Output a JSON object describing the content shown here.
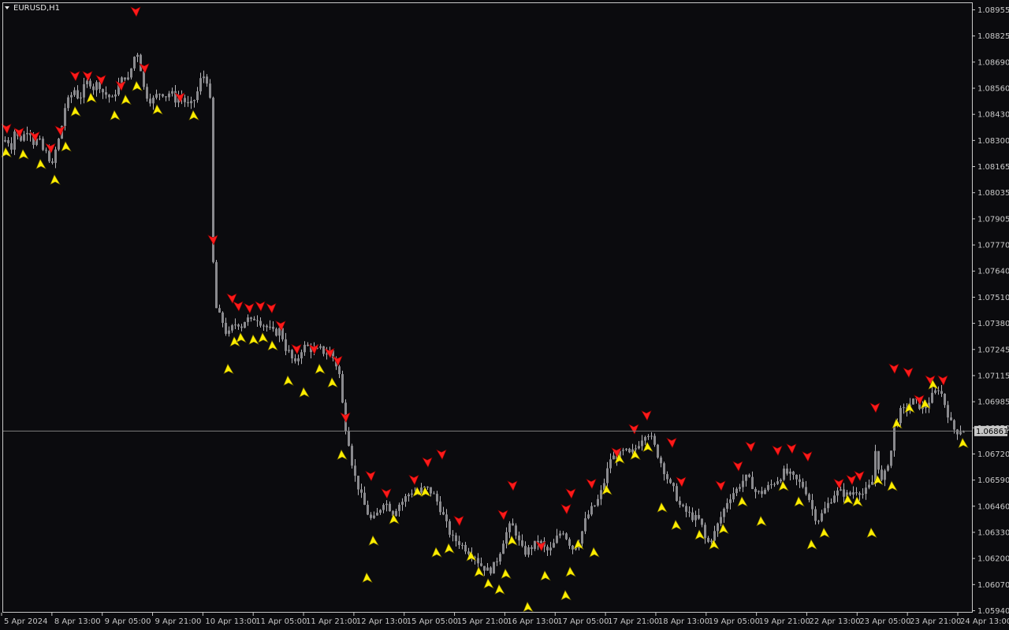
{
  "window": {
    "symbol_label": "EURUSD,H1"
  },
  "colors": {
    "background": "#0b0b0e",
    "candle": "#8a8a8e",
    "wick": "#b4b4b8",
    "axis": "#c8c8c8",
    "sell_arrow": "#ff1a1a",
    "buy_arrow": "#ffee00",
    "current_price_line": "#7c7c7c",
    "current_price_tag": "#c8c8c8"
  },
  "chart_data": {
    "type": "candlestick",
    "title": "EURUSD,H1",
    "ylim": [
      1.0594,
      1.0902
    ],
    "y_ticks": [
      "1.08955",
      "1.08825",
      "1.08690",
      "1.08560",
      "1.08430",
      "1.08300",
      "1.08165",
      "1.08035",
      "1.07905",
      "1.07770",
      "1.07640",
      "1.07510",
      "1.07380",
      "1.07245",
      "1.07115",
      "1.06985",
      "1.06850",
      "1.06720",
      "1.06590",
      "1.06460",
      "1.06330",
      "1.06200",
      "1.06070",
      "1.05940"
    ],
    "x_ticks": [
      "5 Apr 2024",
      "8 Apr 13:00",
      "9 Apr 05:00",
      "9 Apr 21:00",
      "10 Apr 13:00",
      "11 Apr 05:00",
      "11 Apr 21:00",
      "12 Apr 13:00",
      "15 Apr 05:00",
      "15 Apr 21:00",
      "16 Apr 13:00",
      "17 Apr 05:00",
      "17 Apr 21:00",
      "18 Apr 13:00",
      "19 Apr 05:00",
      "19 Apr 21:00",
      "22 Apr 13:00",
      "23 Apr 05:00",
      "23 Apr 21:00",
      "24 Apr 13:00"
    ],
    "current_price": "1.06861",
    "close_path": [
      [
        0,
        1.0833
      ],
      [
        8,
        1.0836
      ],
      [
        14,
        1.0832
      ],
      [
        18,
        1.084
      ],
      [
        24,
        1.0835
      ],
      [
        30,
        1.0838
      ],
      [
        36,
        1.0842
      ],
      [
        42,
        1.0834
      ],
      [
        48,
        1.0836
      ],
      [
        54,
        1.083
      ],
      [
        60,
        1.0828
      ],
      [
        66,
        1.0822
      ],
      [
        70,
        1.083
      ],
      [
        76,
        1.0838
      ],
      [
        82,
        1.0852
      ],
      [
        88,
        1.0857
      ],
      [
        94,
        1.0861
      ],
      [
        100,
        1.0856
      ],
      [
        106,
        1.0862
      ],
      [
        112,
        1.0866
      ],
      [
        118,
        1.0862
      ],
      [
        124,
        1.0865
      ],
      [
        130,
        1.086
      ],
      [
        136,
        1.0858
      ],
      [
        142,
        1.0856
      ],
      [
        148,
        1.0862
      ],
      [
        152,
        1.0865
      ],
      [
        158,
        1.0868
      ],
      [
        162,
        1.0866
      ],
      [
        166,
        1.0872
      ],
      [
        170,
        1.0878
      ],
      [
        174,
        1.088
      ],
      [
        178,
        1.0872
      ],
      [
        182,
        1.0862
      ],
      [
        186,
        1.0858
      ],
      [
        192,
        1.0855
      ],
      [
        198,
        1.0858
      ],
      [
        204,
        1.086
      ],
      [
        210,
        1.0858
      ],
      [
        216,
        1.086
      ],
      [
        222,
        1.0856
      ],
      [
        228,
        1.0858
      ],
      [
        234,
        1.0855
      ],
      [
        240,
        1.0852
      ],
      [
        246,
        1.0856
      ],
      [
        250,
        1.086
      ],
      [
        254,
        1.0866
      ],
      [
        258,
        1.0868
      ],
      [
        262,
        1.0866
      ],
      [
        266,
        1.0855
      ],
      [
        268,
        1.078
      ],
      [
        270,
        1.0772
      ],
      [
        272,
        1.0752
      ],
      [
        276,
        1.0746
      ],
      [
        280,
        1.0744
      ],
      [
        284,
        1.074
      ],
      [
        288,
        1.0734
      ],
      [
        292,
        1.0738
      ],
      [
        296,
        1.074
      ],
      [
        300,
        1.0742
      ],
      [
        306,
        1.074
      ],
      [
        312,
        1.0744
      ],
      [
        318,
        1.0742
      ],
      [
        324,
        1.0745
      ],
      [
        330,
        1.0742
      ],
      [
        336,
        1.074
      ],
      [
        342,
        1.0738
      ],
      [
        348,
        1.0736
      ],
      [
        354,
        1.0738
      ],
      [
        360,
        1.0732
      ],
      [
        364,
        1.0725
      ],
      [
        368,
        1.0728
      ],
      [
        372,
        1.0718
      ],
      [
        376,
        1.0722
      ],
      [
        382,
        1.0728
      ],
      [
        388,
        1.073
      ],
      [
        394,
        1.0728
      ],
      [
        400,
        1.0727
      ],
      [
        406,
        1.0728
      ],
      [
        412,
        1.0726
      ],
      [
        418,
        1.0727
      ],
      [
        424,
        1.0722
      ],
      [
        428,
        1.0718
      ],
      [
        432,
        1.0712
      ],
      [
        434,
        1.07
      ],
      [
        436,
        1.069
      ],
      [
        440,
        1.0686
      ],
      [
        444,
        1.0675
      ],
      [
        448,
        1.0665
      ],
      [
        452,
        1.066
      ],
      [
        456,
        1.0655
      ],
      [
        460,
        1.065
      ],
      [
        464,
        1.0646
      ],
      [
        468,
        1.0642
      ],
      [
        472,
        1.064
      ],
      [
        476,
        1.0642
      ],
      [
        480,
        1.0645
      ],
      [
        486,
        1.065
      ],
      [
        492,
        1.0648
      ],
      [
        498,
        1.0644
      ],
      [
        504,
        1.0648
      ],
      [
        510,
        1.065
      ],
      [
        516,
        1.0653
      ],
      [
        522,
        1.0655
      ],
      [
        528,
        1.0654
      ],
      [
        534,
        1.0656
      ],
      [
        540,
        1.0657
      ],
      [
        546,
        1.0655
      ],
      [
        552,
        1.0652
      ],
      [
        556,
        1.0648
      ],
      [
        560,
        1.0645
      ],
      [
        564,
        1.064
      ],
      [
        568,
        1.0636
      ],
      [
        572,
        1.0632
      ],
      [
        576,
        1.063
      ],
      [
        580,
        1.063
      ],
      [
        584,
        1.0628
      ],
      [
        590,
        1.0626
      ],
      [
        596,
        1.0624
      ],
      [
        602,
        1.0622
      ],
      [
        608,
        1.0618
      ],
      [
        614,
        1.0616
      ],
      [
        620,
        1.0614
      ],
      [
        626,
        1.0617
      ],
      [
        632,
        1.0622
      ],
      [
        638,
        1.063
      ],
      [
        644,
        1.0636
      ],
      [
        648,
        1.0638
      ],
      [
        652,
        1.0636
      ],
      [
        656,
        1.0632
      ],
      [
        660,
        1.0626
      ],
      [
        666,
        1.0624
      ],
      [
        672,
        1.0626
      ],
      [
        678,
        1.0628
      ],
      [
        684,
        1.063
      ],
      [
        690,
        1.0626
      ],
      [
        696,
        1.0624
      ],
      [
        702,
        1.0628
      ],
      [
        708,
        1.0633
      ],
      [
        714,
        1.0635
      ],
      [
        720,
        1.063
      ],
      [
        726,
        1.0626
      ],
      [
        732,
        1.0628
      ],
      [
        736,
        1.0632
      ],
      [
        742,
        1.064
      ],
      [
        748,
        1.0645
      ],
      [
        754,
        1.0648
      ],
      [
        760,
        1.0652
      ],
      [
        766,
        1.066
      ],
      [
        770,
        1.0666
      ],
      [
        774,
        1.0672
      ],
      [
        780,
        1.0673
      ],
      [
        786,
        1.0674
      ],
      [
        792,
        1.0676
      ],
      [
        798,
        1.0674
      ],
      [
        804,
        1.0676
      ],
      [
        810,
        1.068
      ],
      [
        816,
        1.0684
      ],
      [
        820,
        1.0686
      ],
      [
        824,
        1.0684
      ],
      [
        830,
        1.0678
      ],
      [
        836,
        1.0672
      ],
      [
        840,
        1.0668
      ],
      [
        846,
        1.0662
      ],
      [
        850,
        1.0658
      ],
      [
        854,
        1.0656
      ],
      [
        858,
        1.0652
      ],
      [
        862,
        1.0648
      ],
      [
        866,
        1.0646
      ],
      [
        872,
        1.0644
      ],
      [
        878,
        1.0642
      ],
      [
        884,
        1.0641
      ],
      [
        888,
        1.064
      ],
      [
        892,
        1.0634
      ],
      [
        896,
        1.0628
      ],
      [
        900,
        1.063
      ],
      [
        906,
        1.0634
      ],
      [
        912,
        1.064
      ],
      [
        918,
        1.0646
      ],
      [
        922,
        1.065
      ],
      [
        928,
        1.0654
      ],
      [
        934,
        1.0656
      ],
      [
        940,
        1.066
      ],
      [
        946,
        1.0662
      ],
      [
        952,
        1.066
      ],
      [
        958,
        1.0655
      ],
      [
        964,
        1.0654
      ],
      [
        970,
        1.0656
      ],
      [
        976,
        1.0658
      ],
      [
        982,
        1.066
      ],
      [
        988,
        1.0662
      ],
      [
        994,
        1.0665
      ],
      [
        1000,
        1.0664
      ],
      [
        1006,
        1.0662
      ],
      [
        1012,
        1.066
      ],
      [
        1018,
        1.0658
      ],
      [
        1024,
        1.0654
      ],
      [
        1030,
        1.0646
      ],
      [
        1036,
        1.064
      ],
      [
        1040,
        1.0642
      ],
      [
        1046,
        1.0646
      ],
      [
        1052,
        1.065
      ],
      [
        1058,
        1.0654
      ],
      [
        1064,
        1.0655
      ],
      [
        1070,
        1.0654
      ],
      [
        1076,
        1.0653
      ],
      [
        1082,
        1.0655
      ],
      [
        1088,
        1.0656
      ],
      [
        1094,
        1.0654
      ],
      [
        1100,
        1.0656
      ],
      [
        1106,
        1.066
      ],
      [
        1110,
        1.0676
      ],
      [
        1114,
        1.0668
      ],
      [
        1118,
        1.066
      ],
      [
        1122,
        1.0664
      ],
      [
        1126,
        1.067
      ],
      [
        1130,
        1.0676
      ],
      [
        1134,
        1.0688
      ],
      [
        1138,
        1.0692
      ],
      [
        1142,
        1.0696
      ],
      [
        1148,
        1.0697
      ],
      [
        1154,
        1.07
      ],
      [
        1160,
        1.0702
      ],
      [
        1166,
        1.0699
      ],
      [
        1172,
        1.0697
      ],
      [
        1176,
        1.07
      ],
      [
        1180,
        1.0703
      ],
      [
        1186,
        1.0706
      ],
      [
        1190,
        1.0708
      ],
      [
        1194,
        1.0705
      ],
      [
        1198,
        1.07
      ],
      [
        1202,
        1.0695
      ],
      [
        1206,
        1.069
      ],
      [
        1210,
        1.0687
      ],
      [
        1214,
        1.0686
      ],
      [
        1220,
        1.0687
      ],
      [
        1224,
        1.0686
      ]
    ],
    "sell_arrows": [
      [
        8,
        1.0841
      ],
      [
        24,
        1.0839
      ],
      [
        44,
        1.0837
      ],
      [
        64,
        1.0831
      ],
      [
        76,
        1.084
      ],
      [
        95,
        1.0868
      ],
      [
        111,
        1.0868
      ],
      [
        128,
        1.0866
      ],
      [
        153,
        1.0863
      ],
      [
        172,
        1.0901
      ],
      [
        183,
        1.0872
      ],
      [
        228,
        1.0857
      ],
      [
        270,
        1.0784
      ],
      [
        294,
        1.0754
      ],
      [
        302,
        1.075
      ],
      [
        316,
        1.0749
      ],
      [
        330,
        1.075
      ],
      [
        344,
        1.0749
      ],
      [
        356,
        1.074
      ],
      [
        376,
        1.0728
      ],
      [
        398,
        1.0728
      ],
      [
        418,
        1.0726
      ],
      [
        428,
        1.0722
      ],
      [
        438,
        1.0693
      ],
      [
        470,
        1.0663
      ],
      [
        490,
        1.0654
      ],
      [
        525,
        1.0661
      ],
      [
        542,
        1.067
      ],
      [
        560,
        1.0674
      ],
      [
        582,
        1.064
      ],
      [
        638,
        1.0643
      ],
      [
        650,
        1.0658
      ],
      [
        686,
        1.0627
      ],
      [
        718,
        1.0646
      ],
      [
        724,
        1.0654
      ],
      [
        750,
        1.0659
      ],
      [
        782,
        1.0675
      ],
      [
        804,
        1.0687
      ],
      [
        820,
        1.0694
      ],
      [
        852,
        1.068
      ],
      [
        864,
        1.066
      ],
      [
        914,
        1.0658
      ],
      [
        936,
        1.0668
      ],
      [
        952,
        1.0678
      ],
      [
        986,
        1.0676
      ],
      [
        1004,
        1.0677
      ],
      [
        1024,
        1.0673
      ],
      [
        1064,
        1.0659
      ],
      [
        1080,
        1.0661
      ],
      [
        1090,
        1.0663
      ],
      [
        1110,
        1.0698
      ],
      [
        1134,
        1.0718
      ],
      [
        1152,
        1.0716
      ],
      [
        1166,
        1.0702
      ],
      [
        1180,
        1.0712
      ],
      [
        1196,
        1.0712
      ]
    ],
    "buy_arrows": [
      [
        8,
        1.0829
      ],
      [
        30,
        1.0828
      ],
      [
        52,
        1.0823
      ],
      [
        70,
        1.0815
      ],
      [
        84,
        1.0832
      ],
      [
        96,
        1.085
      ],
      [
        116,
        1.0857
      ],
      [
        146,
        1.0848
      ],
      [
        160,
        1.0856
      ],
      [
        174,
        1.0863
      ],
      [
        200,
        1.0851
      ],
      [
        246,
        1.0848
      ],
      [
        290,
        1.0718
      ],
      [
        298,
        1.0732
      ],
      [
        306,
        1.0734
      ],
      [
        322,
        1.0733
      ],
      [
        334,
        1.0734
      ],
      [
        346,
        1.073
      ],
      [
        366,
        1.0712
      ],
      [
        386,
        1.0706
      ],
      [
        406,
        1.0718
      ],
      [
        422,
        1.0711
      ],
      [
        434,
        1.0674
      ],
      [
        474,
        1.063
      ],
      [
        466,
        1.0611
      ],
      [
        500,
        1.0641
      ],
      [
        530,
        1.0655
      ],
      [
        540,
        1.0655
      ],
      [
        554,
        1.0624
      ],
      [
        570,
        1.0626
      ],
      [
        598,
        1.0622
      ],
      [
        608,
        1.0614
      ],
      [
        620,
        1.0608
      ],
      [
        634,
        1.0605
      ],
      [
        642,
        1.0613
      ],
      [
        650,
        1.063
      ],
      [
        670,
        1.0596
      ],
      [
        692,
        1.0612
      ],
      [
        718,
        1.0602
      ],
      [
        724,
        1.0614
      ],
      [
        734,
        1.0628
      ],
      [
        754,
        1.0624
      ],
      [
        770,
        1.0656
      ],
      [
        786,
        1.0672
      ],
      [
        806,
        1.0674
      ],
      [
        822,
        1.0678
      ],
      [
        840,
        1.0647
      ],
      [
        858,
        1.0638
      ],
      [
        888,
        1.0633
      ],
      [
        906,
        1.0628
      ],
      [
        918,
        1.0636
      ],
      [
        942,
        1.065
      ],
      [
        966,
        1.064
      ],
      [
        994,
        1.0658
      ],
      [
        1014,
        1.065
      ],
      [
        1030,
        1.0628
      ],
      [
        1046,
        1.0634
      ],
      [
        1076,
        1.0651
      ],
      [
        1088,
        1.065
      ],
      [
        1106,
        1.0634
      ],
      [
        1114,
        1.0661
      ],
      [
        1132,
        1.0658
      ],
      [
        1138,
        1.069
      ],
      [
        1154,
        1.0698
      ],
      [
        1174,
        1.07
      ],
      [
        1184,
        1.071
      ],
      [
        1222,
        1.068
      ]
    ]
  }
}
